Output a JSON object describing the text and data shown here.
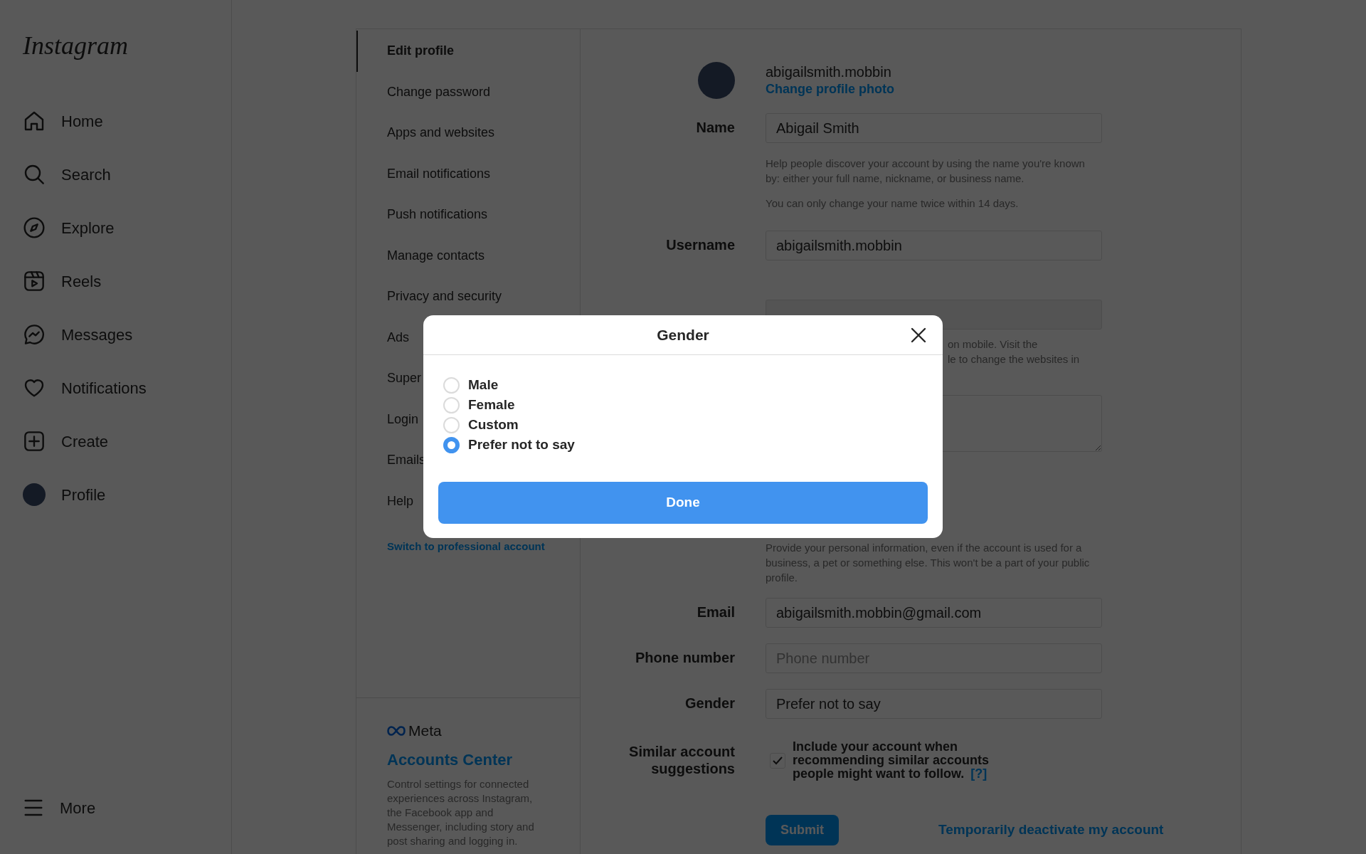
{
  "sidebar": {
    "logo": "Instagram",
    "items": [
      {
        "label": "Home"
      },
      {
        "label": "Search"
      },
      {
        "label": "Explore"
      },
      {
        "label": "Reels"
      },
      {
        "label": "Messages"
      },
      {
        "label": "Notifications"
      },
      {
        "label": "Create"
      },
      {
        "label": "Profile"
      }
    ],
    "more": "More"
  },
  "settings_menu": {
    "items": [
      {
        "label": "Edit profile",
        "selected": true
      },
      {
        "label": "Change password",
        "selected": false
      },
      {
        "label": "Apps and websites",
        "selected": false
      },
      {
        "label": "Email notifications",
        "selected": false
      },
      {
        "label": "Push notifications",
        "selected": false
      },
      {
        "label": "Manage contacts",
        "selected": false
      },
      {
        "label": "Privacy and security",
        "selected": false
      },
      {
        "label": "Ads",
        "selected": false
      },
      {
        "label": "Super",
        "selected": false
      },
      {
        "label": "Login",
        "selected": false
      },
      {
        "label": "Emails",
        "selected": false
      },
      {
        "label": "Help",
        "selected": false
      }
    ],
    "switch_link": "Switch to professional account"
  },
  "accounts_center": {
    "brand": "Meta",
    "title": "Accounts Center",
    "description": "Control settings for connected experiences across Instagram, the Facebook app and Messenger, including story and post sharing and logging in."
  },
  "profile": {
    "username": "abigailsmith.mobbin",
    "change_photo": "Change profile photo"
  },
  "form": {
    "rows": [
      {
        "kind": "field",
        "label": "Name",
        "value": "Abigail Smith",
        "hints": [
          "Help people discover your account by using the name you're known by: either your full name, nickname, or business name.",
          "You can only change your name twice within 14 days."
        ]
      },
      {
        "kind": "field",
        "label": "Username",
        "value": "abigailsmith.mobbin"
      },
      {
        "kind": "blank_field",
        "hint_lines": [
          "on mobile. Visit the",
          "le to change the websites in"
        ]
      },
      {
        "kind": "textarea"
      },
      {
        "kind": "hint",
        "hints": [
          "Provide your personal information, even if the account is used for a business, a pet or something else. This won't be a part of your public profile."
        ]
      },
      {
        "kind": "field",
        "label": "Email",
        "value": "abigailsmith.mobbin@gmail.com"
      },
      {
        "kind": "field",
        "label": "Phone number",
        "placeholder": "Phone number"
      },
      {
        "kind": "field",
        "label": "Gender",
        "value": "Prefer not to say"
      },
      {
        "kind": "checkbox",
        "label": "Similar account suggestions",
        "text": "Include your account when recommending similar accounts people might want to follow.",
        "link": "[?]",
        "checked": true
      }
    ],
    "submit": "Submit",
    "deactivate": "Temporarily deactivate my account"
  },
  "modal": {
    "title": "Gender",
    "options": [
      {
        "label": "Male",
        "selected": false
      },
      {
        "label": "Female",
        "selected": false
      },
      {
        "label": "Custom",
        "selected": false
      },
      {
        "label": "Prefer not to say",
        "selected": true
      }
    ],
    "done": "Done"
  }
}
